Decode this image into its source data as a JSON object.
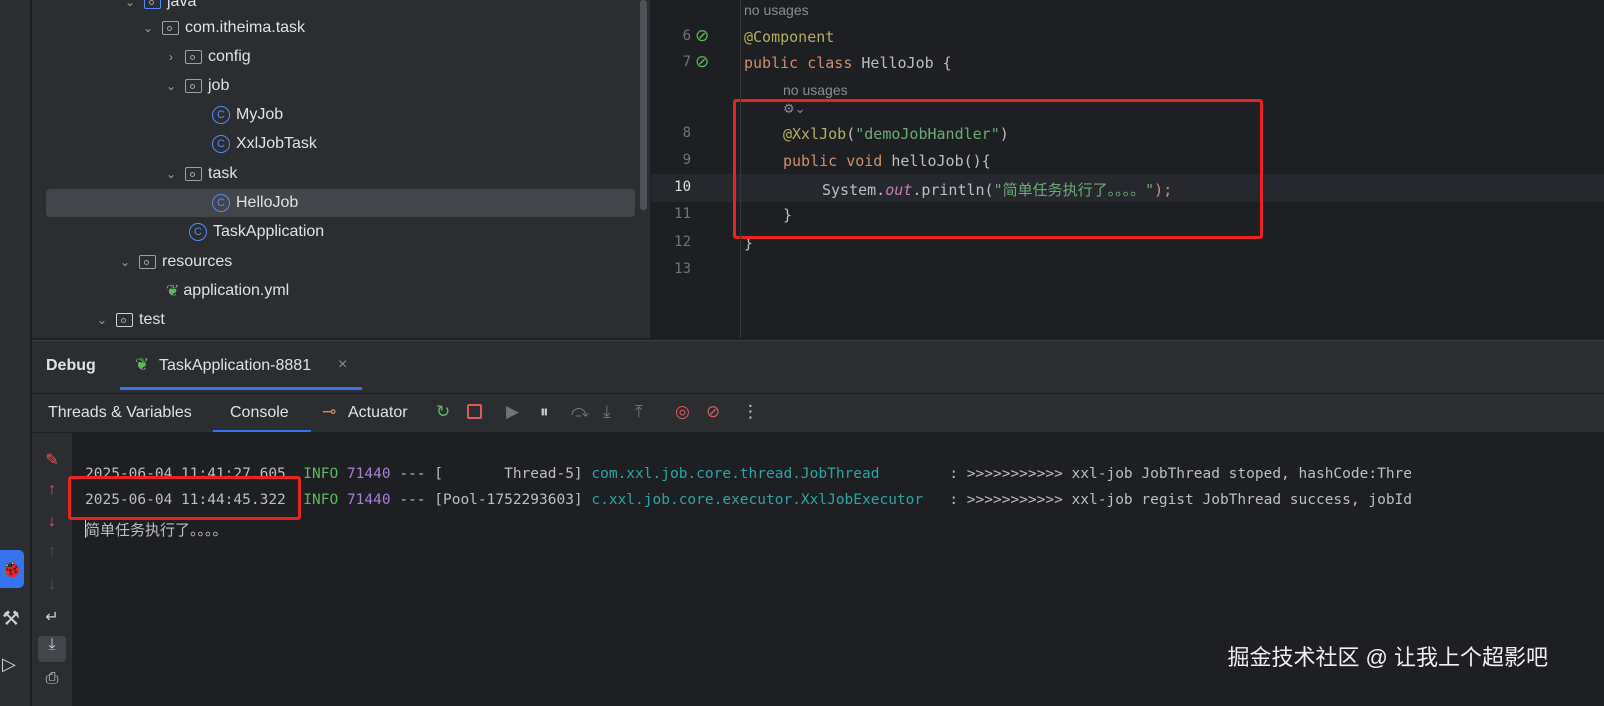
{
  "tree": {
    "items": [
      {
        "label": "java",
        "type": "source-folder"
      },
      {
        "label": "com.itheima.task",
        "type": "package",
        "expanded": true
      },
      {
        "label": "config",
        "type": "package",
        "expanded": false
      },
      {
        "label": "job",
        "type": "package",
        "expanded": true
      },
      {
        "label": "MyJob",
        "type": "class"
      },
      {
        "label": "XxlJobTask",
        "type": "class"
      },
      {
        "label": "task",
        "type": "package",
        "expanded": true
      },
      {
        "label": "HelloJob",
        "type": "class",
        "selected": true
      },
      {
        "label": "TaskApplication",
        "type": "spring-boot-class"
      },
      {
        "label": "resources",
        "type": "resources-folder",
        "expanded": true
      },
      {
        "label": "application.yml",
        "type": "spring-config"
      },
      {
        "label": "test",
        "type": "folder",
        "expanded": true
      }
    ]
  },
  "editor": {
    "hint_usages": "no usages",
    "lines": {
      "l6": "6",
      "l7": "7",
      "l8": "8",
      "l9": "9",
      "l10": "10",
      "l11": "11",
      "l12": "12",
      "l13": "13"
    },
    "code": {
      "component": "@Component",
      "kw_public": "public",
      "kw_class": "class",
      "class_name": " HelloJob {",
      "xxljob": "@XxlJob",
      "xxljob_arg": "\"demoJobHandler\"",
      "kw_void": "void",
      "method": " helloJob(){",
      "sys": "System.",
      "out": "out",
      "println": ".println(",
      "str": "\"简单任务执行了。。。。\"",
      "end": ");",
      "close_brace": "}"
    }
  },
  "debug": {
    "title": "Debug",
    "session_tab": "TaskApplication-8881",
    "tabs": [
      "Threads & Variables",
      "Console",
      "Actuator"
    ],
    "active_tab": "Console"
  },
  "console": {
    "lines": [
      {
        "time": "2025-06-04 11:41:27.605",
        "level": "INFO",
        "pid": "71440",
        "sep": "---",
        "thread": "[       Thread-5]",
        "logger": "com.xxl.job.core.thread.JobThread       ",
        "msg": ": >>>>>>>>>>> xxl-job JobThread stoped, hashCode:Thre"
      },
      {
        "time": "2025-06-04 11:44:45.322",
        "level": "INFO",
        "pid": "71440",
        "sep": "---",
        "thread": "[Pool-1752293603]",
        "logger": "c.xxl.job.core.executor.XxlJobExecutor  ",
        "msg": ": >>>>>>>>>>> xxl-job regist JobThread success, jobId"
      }
    ],
    "output": "简单任务执行了。。。。"
  },
  "watermark": "掘金技术社区 @ 让我上个超影吧",
  "colors": {
    "highlight": "#e5261e",
    "accent": "#548af7"
  }
}
